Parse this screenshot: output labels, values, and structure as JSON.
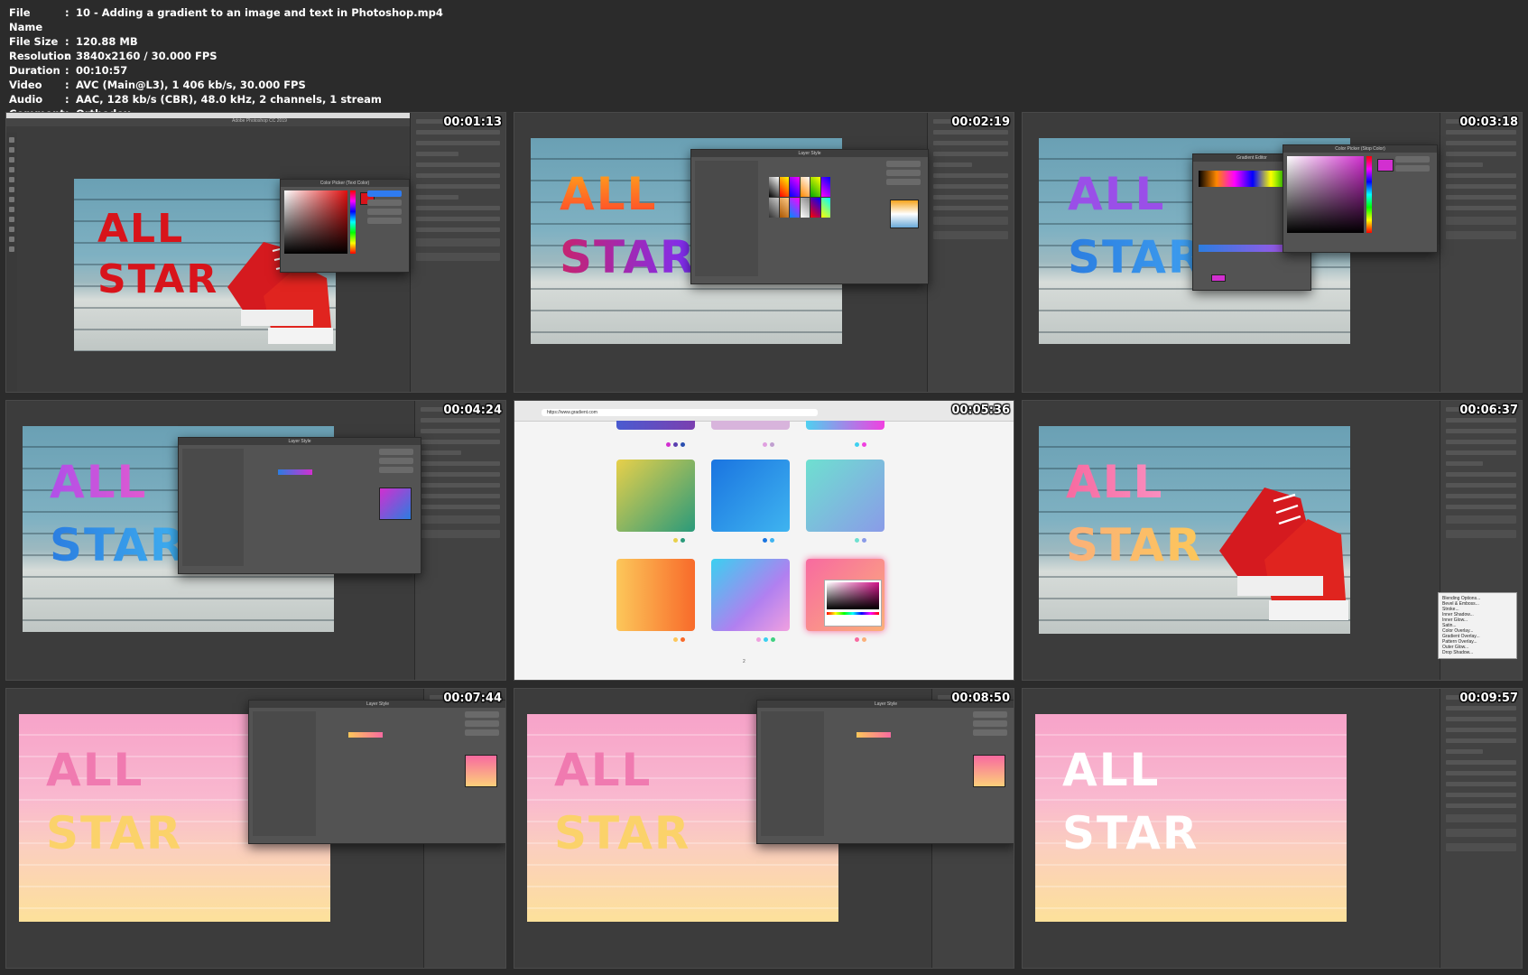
{
  "meta": [
    {
      "key": "File Name",
      "value": "10 - Adding a gradient to an image and text in Photoshop.mp4"
    },
    {
      "key": "File Size",
      "value": "120.88 MB"
    },
    {
      "key": "Resolution",
      "value": "3840x2160 / 30.000 FPS"
    },
    {
      "key": "Duration",
      "value": "00:10:57"
    },
    {
      "key": "Video",
      "value": "AVC (Main@L3), 1 406 kb/s, 30.000 FPS"
    },
    {
      "key": "Audio",
      "value": "AAC, 128 kb/s (CBR), 48.0 kHz, 2 channels, 1 stream"
    },
    {
      "key": "Comment",
      "value": "Orthodox"
    }
  ],
  "meta_separator": ":",
  "thumbs": [
    {
      "timestamp": "00:01:13",
      "word1": "ALL",
      "word2": "STAR",
      "dialog_title": "Color Picker (Text Color)",
      "app_title": "Adobe Photoshop CC 2019"
    },
    {
      "timestamp": "00:02:19",
      "word1": "ALL",
      "word2": "STAR",
      "dialog_title": "Layer Style"
    },
    {
      "timestamp": "00:03:18",
      "word1": "ALL",
      "word2": "STAR",
      "dialog_title": "Color Picker (Stop Color)",
      "dialog2_title": "Gradient Editor"
    },
    {
      "timestamp": "00:04:24",
      "word1": "ALL",
      "word2": "STAR",
      "dialog_title": "Layer Style"
    },
    {
      "timestamp": "00:05:36",
      "url": "https://www.gradient.com",
      "page_num": "2"
    },
    {
      "timestamp": "00:06:37",
      "word1": "ALL",
      "word2": "STAR",
      "context_menu": [
        "Blending Options...",
        "Bevel & Emboss...",
        "Stroke...",
        "Inner Shadow...",
        "Inner Glow...",
        "Satin...",
        "Color Overlay...",
        "Gradient Overlay...",
        "Pattern Overlay...",
        "Outer Glow...",
        "Drop Shadow..."
      ]
    },
    {
      "timestamp": "00:07:44",
      "word1": "ALL",
      "word2": "STAR",
      "dialog_title": "Layer Style"
    },
    {
      "timestamp": "00:08:50",
      "word1": "ALL",
      "word2": "STAR",
      "dialog_title": "Layer Style"
    },
    {
      "timestamp": "00:09:57",
      "word1": "ALL",
      "word2": "STAR"
    }
  ],
  "colors": {
    "red_text": "#d8141b",
    "grad_orange": "#ff7a1c",
    "grad_purple": "#7b2ff7",
    "pink": "#f59ac4",
    "yellow": "#fbd26a"
  }
}
